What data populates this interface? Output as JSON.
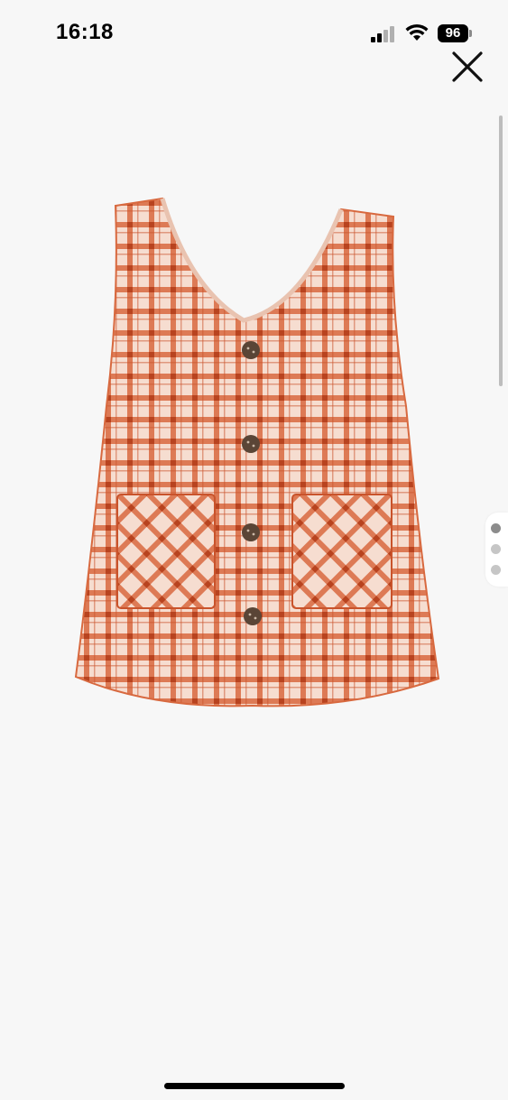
{
  "status_bar": {
    "time": "16:18",
    "battery_level": "96",
    "signal_bars": 2,
    "icons": [
      "signal-icon",
      "wifi-icon",
      "battery-icon"
    ]
  },
  "toolbar": {
    "close_icon": "close-icon"
  },
  "gallery": {
    "image_description_icon": "product-photo",
    "pager": {
      "total": 3,
      "active_index": 0,
      "active_color": "#8c8c8c",
      "inactive_color": "#c6c6c6"
    }
  },
  "colors": {
    "background": "#f7f7f7",
    "plaid_rust": "#c9532b",
    "plaid_cream": "#f6ddd0",
    "button_brown": "#5a4536"
  }
}
